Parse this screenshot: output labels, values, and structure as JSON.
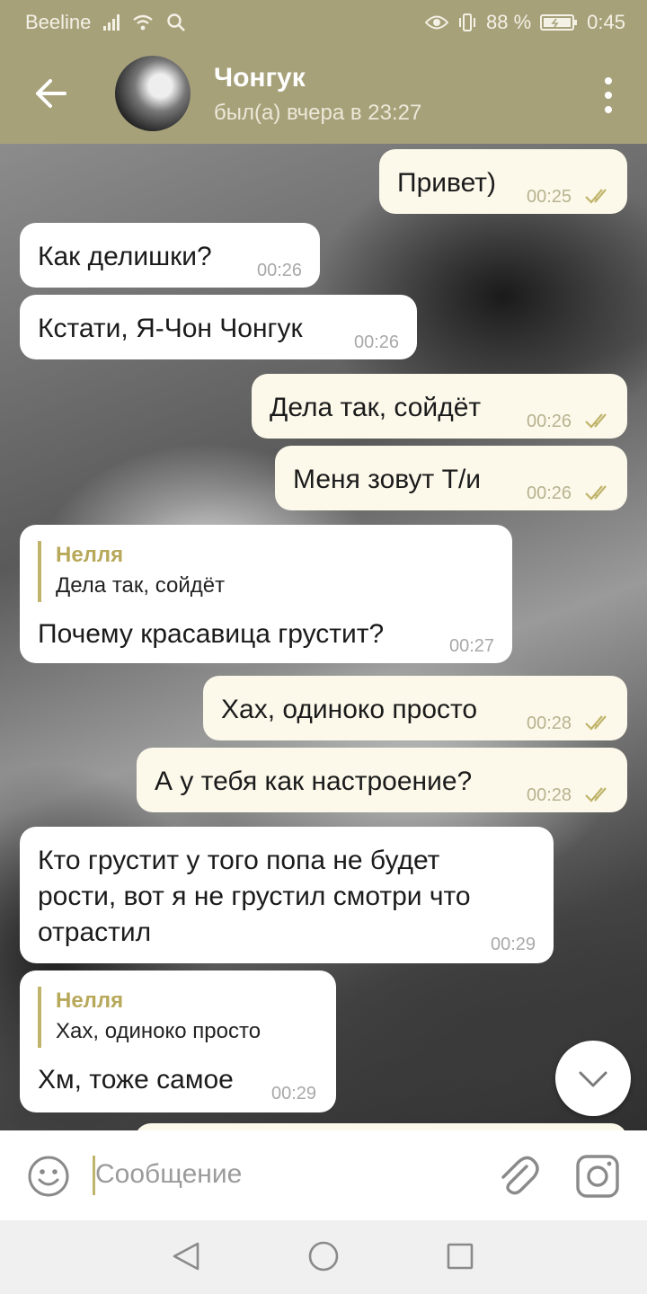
{
  "status_bar": {
    "carrier": "Beeline",
    "battery": "88 %",
    "time": "0:45"
  },
  "header": {
    "name": "Чонгук",
    "last_seen": "был(а) вчера в 23:27"
  },
  "messages": [
    {
      "dir": "out",
      "text": "Привет)",
      "time": "00:25",
      "read": true
    },
    {
      "dir": "in",
      "text": "Как делишки?",
      "time": "00:26"
    },
    {
      "dir": "in",
      "text": "Кстати, Я-Чон Чонгук",
      "time": "00:26"
    },
    {
      "dir": "out",
      "text": "Дела так, сойдёт",
      "time": "00:26",
      "read": true
    },
    {
      "dir": "out",
      "text": "Меня зовут Т/и",
      "time": "00:26",
      "read": true
    },
    {
      "dir": "in",
      "reply_name": "Нелля",
      "reply_text": "Дела так, сойдёт",
      "text": "Почему красавица грустит?",
      "time": "00:27"
    },
    {
      "dir": "out",
      "text": "Хах, одиноко просто",
      "time": "00:28",
      "read": true
    },
    {
      "dir": "out",
      "text": "А у тебя как настроение?",
      "time": "00:28",
      "read": true
    },
    {
      "dir": "in",
      "lines": [
        "Кто грустит у того попа не будет",
        "рости, вот я не грустил смотри что",
        "отрастил"
      ],
      "time": "00:29"
    },
    {
      "dir": "in",
      "reply_name": "Нелля",
      "reply_text": "Хах, одиноко просто",
      "text": "Хм, тоже самое",
      "time": "00:29"
    }
  ],
  "input": {
    "placeholder": "Сообщение"
  },
  "colors": {
    "accent": "#a7a17a",
    "outgoing_bubble": "#fcf9eb",
    "incoming_bubble": "#ffffff",
    "check": "#c0b46a"
  },
  "icons": [
    "back-arrow-icon",
    "more-vert-icon",
    "double-check-icon",
    "chevron-down-icon",
    "emoji-icon",
    "attach-icon",
    "camera-icon",
    "nav-back-icon",
    "nav-home-icon",
    "nav-recent-icon"
  ]
}
